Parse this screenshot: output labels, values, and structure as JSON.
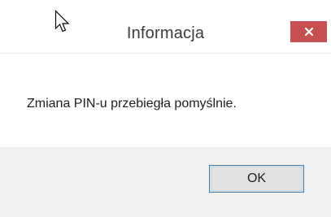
{
  "dialog": {
    "title": "Informacja",
    "message": "Zmiana PIN-u przebiegła pomyślnie.",
    "ok_label": "OK",
    "close_icon": "close-icon",
    "accent_close": "#c75050",
    "footer_bg": "#f0f0f0",
    "ok_border": "#3c7fb1"
  },
  "cursor": {
    "icon": "mouse-pointer-icon"
  }
}
